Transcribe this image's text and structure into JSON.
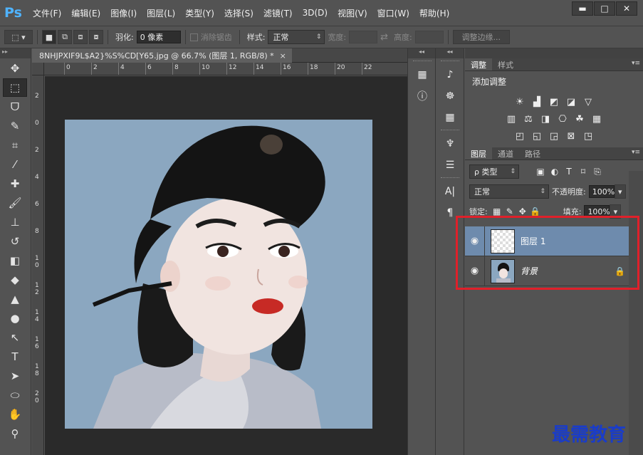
{
  "app": {
    "logo": "Ps"
  },
  "menu": [
    "文件(F)",
    "编辑(E)",
    "图像(I)",
    "图层(L)",
    "类型(Y)",
    "选择(S)",
    "滤镜(T)",
    "3D(D)",
    "视图(V)",
    "窗口(W)",
    "帮助(H)"
  ],
  "window_controls": {
    "minimize": "▬",
    "restore": "□",
    "close": "✕"
  },
  "options": {
    "feather_label": "羽化:",
    "feather_value": "0 像素",
    "antialias_label": "消除锯齿",
    "style_label": "样式:",
    "style_value": "正常",
    "width_label": "宽度:",
    "height_label": "高度:",
    "refine_edge": "调整边缘..."
  },
  "document": {
    "tab_title": "8NHJPXIF9L$A2}%S%CD[Y65.jpg @ 66.7% (图层 1, RGB/8) *",
    "close": "×",
    "ruler_top": [
      "0",
      "2",
      "4",
      "6",
      "8",
      "10",
      "12",
      "14",
      "16",
      "18",
      "20",
      "22"
    ],
    "ruler_left": [
      "2",
      "0",
      "2",
      "4",
      "6",
      "8",
      "1 0",
      "1 2",
      "1 4",
      "1 6",
      "1 8",
      "2 0"
    ]
  },
  "adjustments": {
    "tabs": [
      "调整",
      "样式"
    ],
    "title": "添加调整"
  },
  "layers_panel": {
    "tabs": [
      "图层",
      "通道",
      "路径"
    ],
    "filter_label": "ρ 类型",
    "blend_mode": "正常",
    "opacity_label": "不透明度:",
    "opacity_value": "100%",
    "lock_label": "锁定:",
    "fill_label": "填充:",
    "fill_value": "100%",
    "layers": [
      {
        "name": "图层 1",
        "selected": true,
        "locked": false
      },
      {
        "name": "背景",
        "selected": false,
        "locked": true
      }
    ]
  },
  "watermark": "最需教育",
  "colors": {
    "highlight_box": "#e0202a",
    "selected_layer": "#6e8bad",
    "artwork_bg": "#8ba7c0"
  }
}
